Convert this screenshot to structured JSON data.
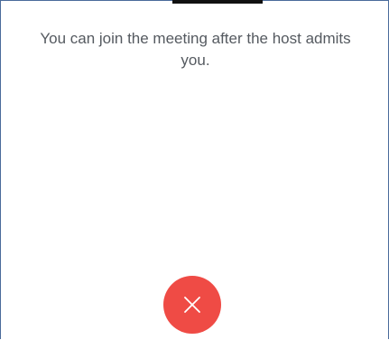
{
  "waiting_room": {
    "message": "You can join the meeting after the host admits you.",
    "leave_button": {
      "icon": "close-icon",
      "color": "#ef4b45"
    }
  }
}
